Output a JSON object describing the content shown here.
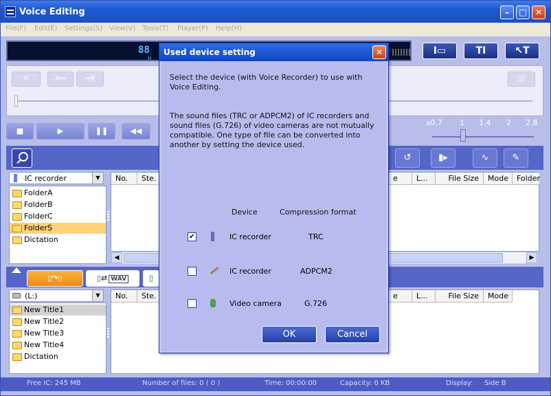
{
  "window": {
    "title": "Voice Editing"
  },
  "menu": [
    "File(F)",
    "Edit(E)",
    "Settings(S)",
    "View(V)",
    "Tools(T)",
    "Player(P)",
    "Help(H)"
  ],
  "lcd": {
    "digits": "88",
    "sub": "H"
  },
  "right_buttons": [
    "Ⅰ▭",
    "TⅠ",
    "↖T"
  ],
  "speed_labels": [
    "x0.7",
    "1",
    "1.4",
    "2",
    "2.8"
  ],
  "top_tree": {
    "combo_label": "IC recorder",
    "folders": [
      "FolderA",
      "FolderB",
      "FolderC",
      "FolderS",
      "Dictation"
    ],
    "selected": "FolderS"
  },
  "top_list_headers": [
    "No.",
    "Ste.",
    "e",
    "L...",
    "File Size",
    "Mode",
    "Folder"
  ],
  "bottom_tree": {
    "combo_label": "(L:)",
    "folders": [
      "New Title1",
      "New Title2",
      "New Title3",
      "New Title4",
      "Dictation"
    ],
    "selected": "New Title1"
  },
  "bottom_list_headers": [
    "No.",
    "Ste.",
    "e",
    "L...",
    "File Size",
    "Mode"
  ],
  "tabs": {
    "wav_label": "WAV"
  },
  "status": {
    "free": "Free IC: 245 MB",
    "files": "Number of files: 0 ( 0 )",
    "time": "Time: 00:00:00",
    "capacity": "Capacity:  0 KB",
    "display": "Display:",
    "display_value": "Side B"
  },
  "dialog": {
    "title": "Used device setting",
    "close": "✕",
    "intro": "Select the device (with Voice Recorder) to use with Voice Editing.",
    "note": "The sound files (TRC or ADPCM2) of IC recorders and sound files (G.726) of video cameras are not mutually compatible. One type of file can be converted into another by setting the device used.",
    "col_device": "Device",
    "col_format": "Compression format",
    "devices": [
      {
        "name": "IC recorder",
        "format": "TRC",
        "checked": true,
        "icon": "ic-recorder-icon"
      },
      {
        "name": "IC recorder",
        "format": "ADPCM2",
        "checked": false,
        "icon": "pen-recorder-icon"
      },
      {
        "name": "Video camera",
        "format": "G.726",
        "checked": false,
        "icon": "video-camera-icon"
      }
    ],
    "ok": "OK",
    "cancel": "Cancel"
  }
}
